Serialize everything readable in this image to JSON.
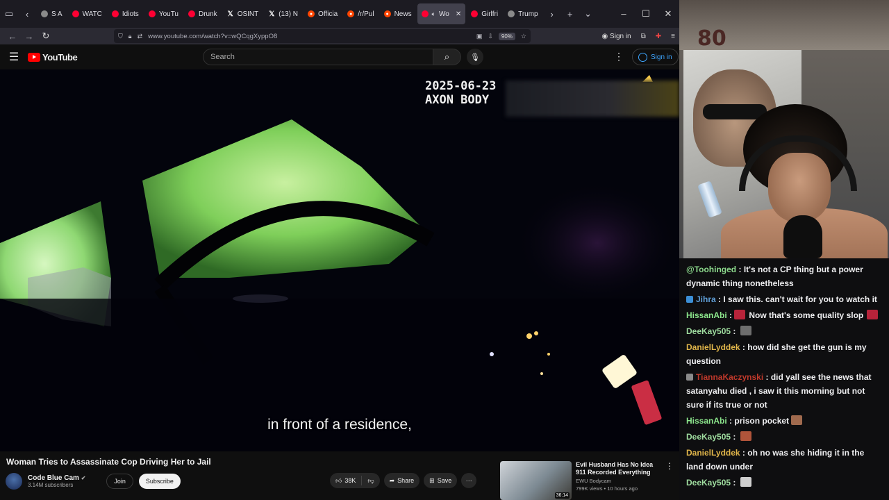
{
  "browser": {
    "tabs": [
      {
        "label": "S A",
        "icon": "generic"
      },
      {
        "label": "WATC",
        "icon": "youtube"
      },
      {
        "label": "Idiots",
        "icon": "youtube"
      },
      {
        "label": "YouTu",
        "icon": "youtube"
      },
      {
        "label": "Drunk",
        "icon": "youtube"
      },
      {
        "label": "OSINT",
        "icon": "x"
      },
      {
        "label": "(13) N",
        "icon": "x"
      },
      {
        "label": "Officia",
        "icon": "reddit"
      },
      {
        "label": "/r/Pul",
        "icon": "reddit"
      },
      {
        "label": "News",
        "icon": "reddit"
      },
      {
        "label": "Wo",
        "icon": "youtube",
        "active": true
      },
      {
        "label": "Girlfri",
        "icon": "youtube"
      },
      {
        "label": "Trump",
        "icon": "generic"
      }
    ],
    "url": "www.youtube.com/watch?v=wQCqgXyppO8",
    "zoom": "90%",
    "sign_in": "Sign in"
  },
  "youtube": {
    "logo_text": "YouTube",
    "search_placeholder": "Search",
    "sign_in": "Sign in"
  },
  "video": {
    "timestamp_date": "2025-06-23",
    "timestamp_device": "AXON BODY",
    "caption": "in front of a residence,",
    "title": "Woman Tries to Assassinate Cop Driving Her to Jail",
    "channel_name": "Code Blue Cam",
    "channel_subs": "3.14M subscribers",
    "join_label": "Join",
    "subscribe_label": "Subscribe",
    "likes": "38K",
    "share_label": "Share",
    "save_label": "Save"
  },
  "recommended": {
    "title": "Evil Husband Has No Idea 911 Recorded Everything",
    "channel": "EWU Bodycam",
    "meta": "799K views • 10 hours ago",
    "duration": "36:14"
  },
  "webcam": {
    "badge_text": "80"
  },
  "chat": {
    "messages": [
      {
        "user": "@Toohinged",
        "color": "#8cd98c",
        "badge": "",
        "text": "It's not a CP thing but a power dynamic thing nonetheless",
        "emote": ""
      },
      {
        "user": "Jihra",
        "color": "#5f9ed6",
        "badge": "#3c8fd6",
        "text": "I saw this. can't wait for you to watch it",
        "emote": ""
      },
      {
        "user": "HissanAbi",
        "color": "#8ce68c",
        "badge": "",
        "text": "Now that's some quality slop",
        "emote": "#b7233a",
        "emote_before": true
      },
      {
        "user": "DeeKay505",
        "color": "#9fdc9f",
        "badge": "",
        "text": "",
        "emote": "#6e6e6e"
      },
      {
        "user": "DanielLyddek",
        "color": "#e0b54a",
        "badge": "",
        "text": "how did she get the gun is my question",
        "emote": ""
      },
      {
        "user": "TiannaKaczynski",
        "color": "#c0392b",
        "badge": "#8a8a8a",
        "text": "did yall see the news that satanyahu died , i saw it this morning but not sure if its true or not",
        "emote": ""
      },
      {
        "user": "HissanAbi",
        "color": "#8ce68c",
        "badge": "",
        "text": "prison pocket",
        "emote": "#a06a4e"
      },
      {
        "user": "DeeKay505",
        "color": "#9fdc9f",
        "badge": "",
        "text": "",
        "emote": "#b0543a"
      },
      {
        "user": "DanielLyddek",
        "color": "#e0b54a",
        "badge": "",
        "text": "oh no was she hiding it in the land down under",
        "emote": ""
      },
      {
        "user": "DeeKay505",
        "color": "#9fdc9f",
        "badge": "",
        "text": "",
        "emote": "#cfcfcf"
      }
    ]
  }
}
